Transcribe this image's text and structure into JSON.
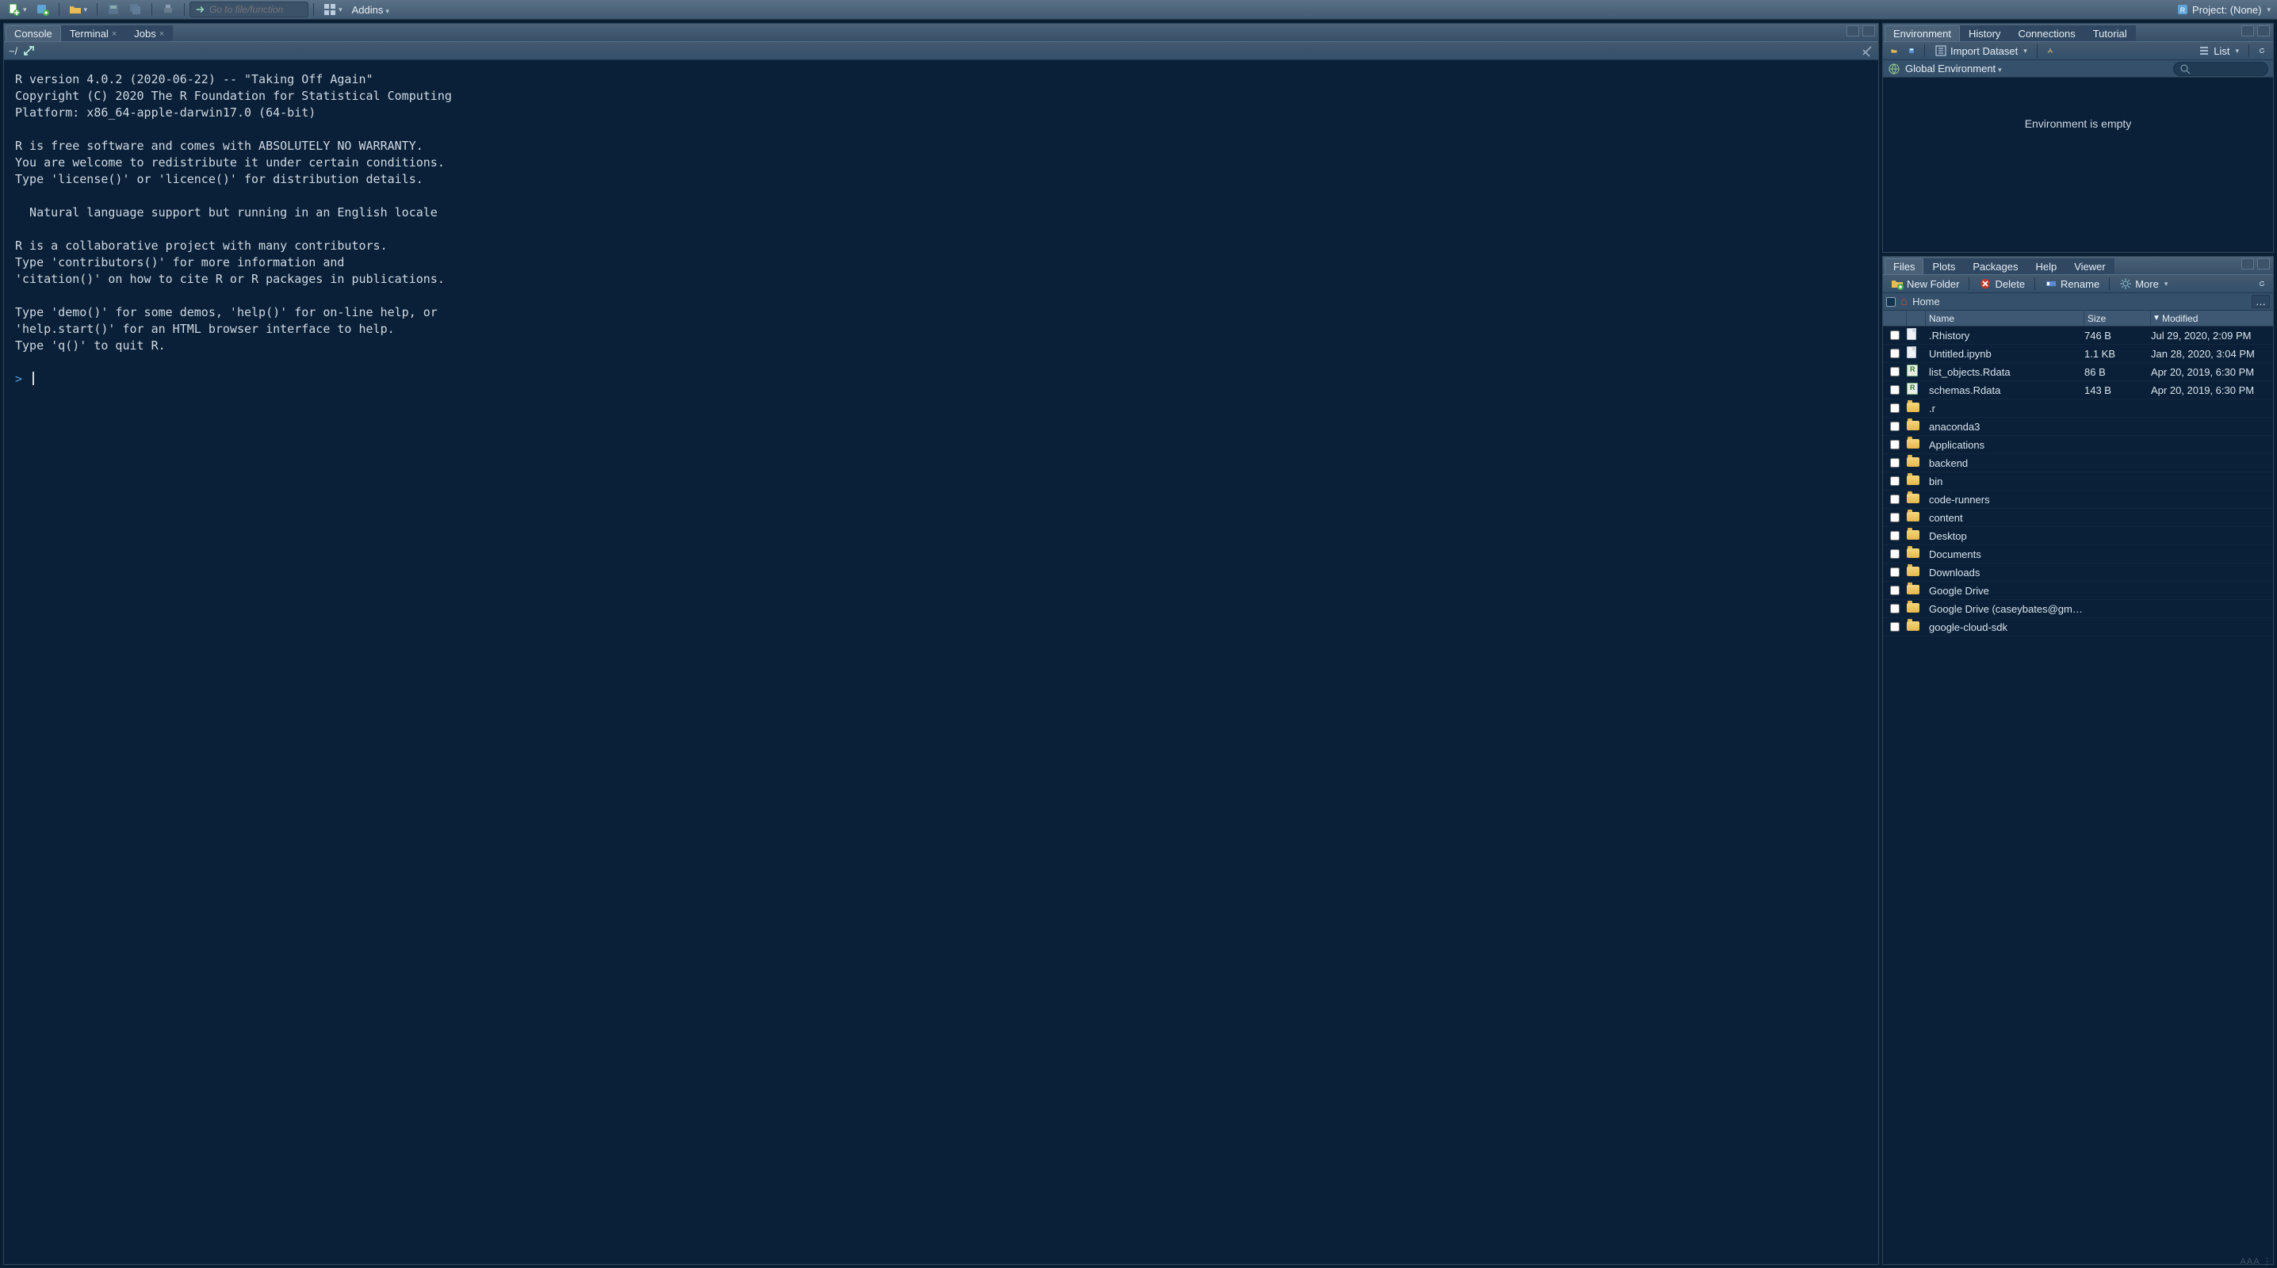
{
  "toolbar": {
    "goto_placeholder": "Go to file/function",
    "addins_label": "Addins",
    "project_label": "Project: (None)"
  },
  "left": {
    "tabs": [
      {
        "label": "Console",
        "closable": false,
        "active": true
      },
      {
        "label": "Terminal",
        "closable": true,
        "active": false
      },
      {
        "label": "Jobs",
        "closable": true,
        "active": false
      }
    ],
    "prompt_path": "~/",
    "console_text": "R version 4.0.2 (2020-06-22) -- \"Taking Off Again\"\nCopyright (C) 2020 The R Foundation for Statistical Computing\nPlatform: x86_64-apple-darwin17.0 (64-bit)\n\nR is free software and comes with ABSOLUTELY NO WARRANTY.\nYou are welcome to redistribute it under certain conditions.\nType 'license()' or 'licence()' for distribution details.\n\n  Natural language support but running in an English locale\n\nR is a collaborative project with many contributors.\nType 'contributors()' for more information and\n'citation()' on how to cite R or R packages in publications.\n\nType 'demo()' for some demos, 'help()' for on-line help, or\n'help.start()' for an HTML browser interface to help.\nType 'q()' to quit R.\n",
    "prompt": "> "
  },
  "env_pane": {
    "tabs": [
      {
        "label": "Environment",
        "active": true
      },
      {
        "label": "History",
        "active": false
      },
      {
        "label": "Connections",
        "active": false
      },
      {
        "label": "Tutorial",
        "active": false
      }
    ],
    "import_label": "Import Dataset",
    "list_label": "List",
    "scope_label": "Global Environment",
    "empty_msg": "Environment is empty"
  },
  "files_pane": {
    "tabs": [
      {
        "label": "Files",
        "active": true
      },
      {
        "label": "Plots",
        "active": false
      },
      {
        "label": "Packages",
        "active": false
      },
      {
        "label": "Help",
        "active": false
      },
      {
        "label": "Viewer",
        "active": false
      }
    ],
    "new_folder": "New Folder",
    "delete": "Delete",
    "rename": "Rename",
    "more": "More",
    "breadcrumb": "Home",
    "headers": {
      "name": "Name",
      "size": "Size",
      "modified": "Modified"
    },
    "rows": [
      {
        "icon": "file",
        "name": ".Rhistory",
        "size": "746 B",
        "modified": "Jul 29, 2020, 2:09 PM"
      },
      {
        "icon": "file",
        "name": "Untitled.ipynb",
        "size": "1.1 KB",
        "modified": "Jan 28, 2020, 3:04 PM"
      },
      {
        "icon": "rdata",
        "name": "list_objects.Rdata",
        "size": "86 B",
        "modified": "Apr 20, 2019, 6:30 PM"
      },
      {
        "icon": "rdata",
        "name": "schemas.Rdata",
        "size": "143 B",
        "modified": "Apr 20, 2019, 6:30 PM"
      },
      {
        "icon": "folder",
        "name": ".r",
        "size": "",
        "modified": ""
      },
      {
        "icon": "folder",
        "name": "anaconda3",
        "size": "",
        "modified": ""
      },
      {
        "icon": "folder",
        "name": "Applications",
        "size": "",
        "modified": ""
      },
      {
        "icon": "folder",
        "name": "backend",
        "size": "",
        "modified": ""
      },
      {
        "icon": "folder",
        "name": "bin",
        "size": "",
        "modified": ""
      },
      {
        "icon": "folder",
        "name": "code-runners",
        "size": "",
        "modified": ""
      },
      {
        "icon": "folder",
        "name": "content",
        "size": "",
        "modified": ""
      },
      {
        "icon": "folder",
        "name": "Desktop",
        "size": "",
        "modified": ""
      },
      {
        "icon": "folder",
        "name": "Documents",
        "size": "",
        "modified": ""
      },
      {
        "icon": "folder",
        "name": "Downloads",
        "size": "",
        "modified": ""
      },
      {
        "icon": "folder",
        "name": "Google Drive",
        "size": "",
        "modified": ""
      },
      {
        "icon": "folder",
        "name": "Google Drive (caseybates@gmai...",
        "size": "",
        "modified": ""
      },
      {
        "icon": "folder",
        "name": "google-cloud-sdk",
        "size": "",
        "modified": ""
      }
    ]
  }
}
